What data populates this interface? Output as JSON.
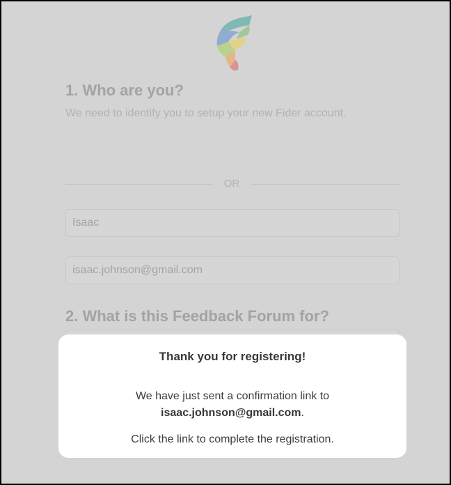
{
  "form": {
    "step1_title": "1. Who are you?",
    "step1_subtitle": "We need to identify you to setup your new Fider account.",
    "or_label": "OR",
    "name_value": "Isaac",
    "email_value": "isaac.johnson@gmail.com",
    "step2_title": "2. What is this Feedback Forum for?"
  },
  "modal": {
    "title": "Thank you for registering!",
    "line1": "We have just sent a confirmation link to",
    "email": "isaac.johnson@gmail.com",
    "email_suffix": ".",
    "line3": "Click the link to complete the registration."
  },
  "logo": {
    "icon": "fider-logo-icon",
    "colors": [
      "#6f9fd8",
      "#7cc47a",
      "#f0d84f",
      "#f0a04b",
      "#e06a6a"
    ]
  }
}
